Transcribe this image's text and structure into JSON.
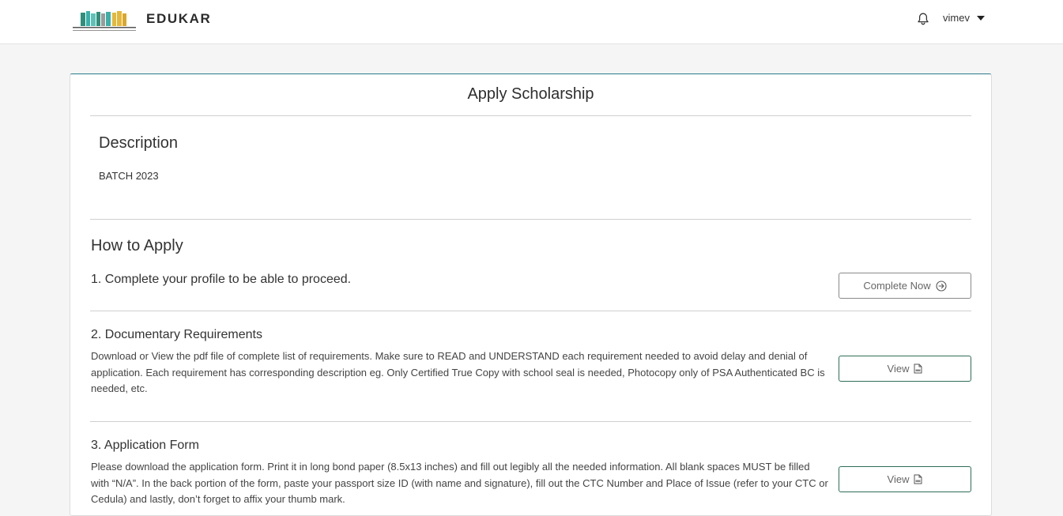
{
  "header": {
    "brand": "EDUKAR",
    "user": "vimev",
    "icons": [
      "bookshelf-logo",
      "bell-icon",
      "caret-down-icon"
    ],
    "logo_colors": [
      "#2f8f7a",
      "#3bb0a8",
      "#5fc1b5",
      "#e4b83a",
      "#9a9a9a"
    ]
  },
  "card": {
    "title": "Apply Scholarship",
    "accent_color": "#2a7a8a"
  },
  "description": {
    "heading": "Description",
    "text": "BATCH 2023"
  },
  "how_to_apply": {
    "heading": "How to Apply",
    "step1": {
      "title": "1. Complete your profile to be able to proceed.",
      "button": "Complete Now",
      "icon": "arrow-circle-right-icon"
    },
    "step2": {
      "title": "2. Documentary Requirements",
      "text": "Download or View the pdf file of complete list of requirements. Make sure to READ and UNDERSTAND each requirement needed to avoid delay and denial of application. Each requirement has corresponding description eg. Only Certified True Copy with school seal is needed, Photocopy only of PSA Authenticated BC is needed, etc.",
      "button": "View",
      "icon": "pdf-file-icon"
    },
    "step3": {
      "title": "3. Application Form",
      "text": "Please download the application form. Print it in long bond paper (8.5x13 inches) and fill out legibly all the needed information. All blank spaces MUST be filled with “N/A”. In the back portion of the form, paste your passport size ID (with name and signature), fill out the CTC Number and Place of Issue (refer to your CTC or Cedula) and lastly, don’t forget to affix your thumb mark.",
      "button": "View",
      "icon": "pdf-file-icon"
    }
  }
}
